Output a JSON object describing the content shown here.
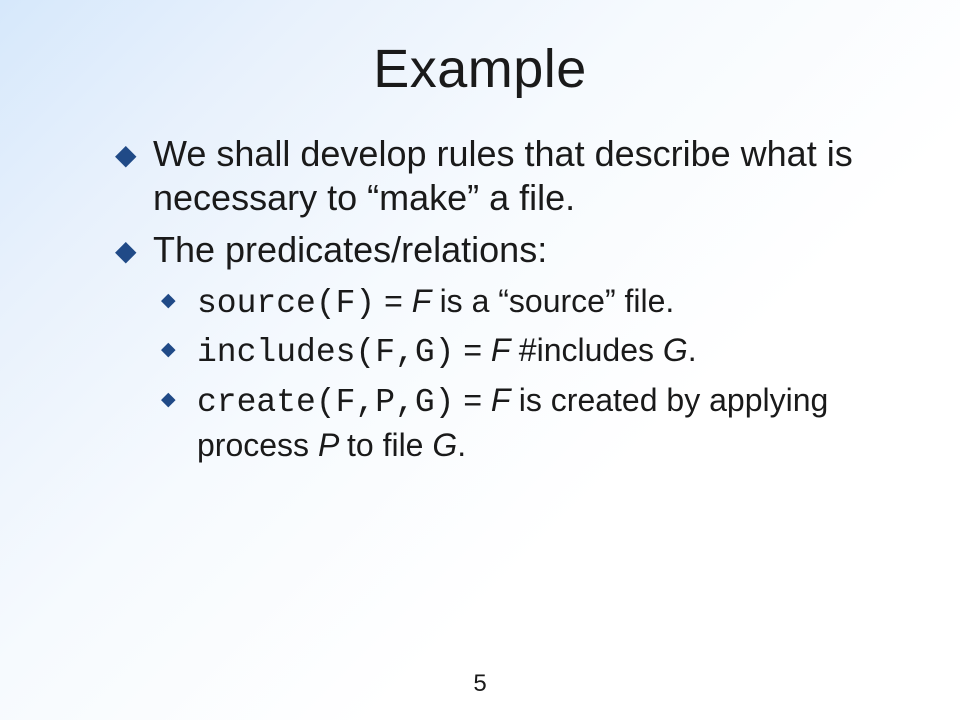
{
  "title": "Example",
  "bullets": {
    "b1": "We shall develop rules that describe what is necessary to “make” a file.",
    "b2": "The predicates/relations:",
    "s1_code": "source(F)",
    "s1_eq": " = ",
    "s1_var": "F ",
    "s1_rest": " is a “source” file.",
    "s2_code": "includes(F,G)",
    "s2_eq": " = ",
    "s2_var": "F ",
    "s2_rest": " #includes ",
    "s2_var2": "G",
    "s2_period": ".",
    "s3_code": "create(F,P,G)",
    "s3_eq": " = ",
    "s3_var": "F ",
    "s3_rest1": " is created by applying process ",
    "s3_var2": "P ",
    "s3_rest2": " to file ",
    "s3_var3": "G",
    "s3_period": "."
  },
  "page": "5"
}
